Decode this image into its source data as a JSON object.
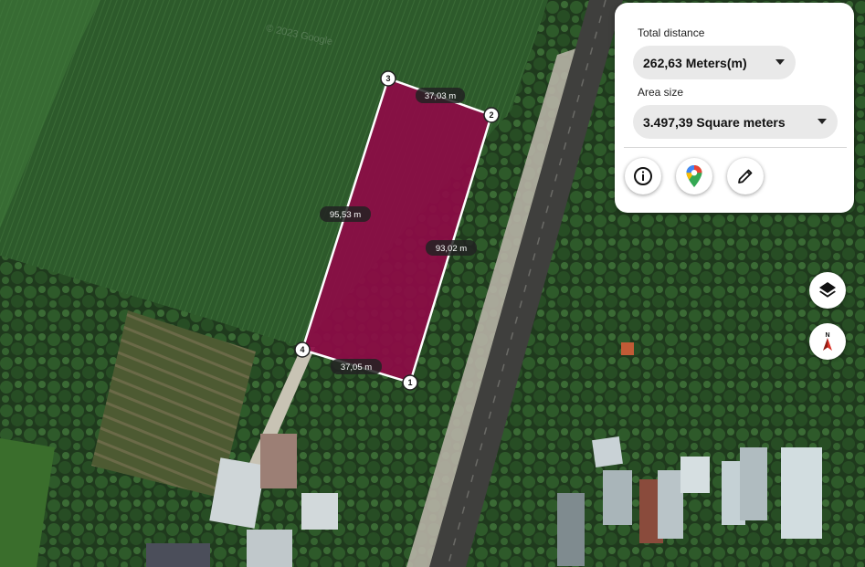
{
  "measure_panel": {
    "distance_label": "Total distance",
    "distance_value": "262,63 Meters(m)",
    "area_label": "Area size",
    "area_value": "3.497,39 Square meters"
  },
  "polygon": {
    "fill_color": "#8e0b46",
    "stroke_color": "#ffffff",
    "vertices": [
      {
        "label": "1"
      },
      {
        "label": "2"
      },
      {
        "label": "3"
      },
      {
        "label": "4"
      }
    ],
    "edges": [
      {
        "label": "37,03 m"
      },
      {
        "label": "95,53 m"
      },
      {
        "label": "93,02 m"
      },
      {
        "label": "37,05 m"
      }
    ]
  },
  "watermark": "© 2023 Google",
  "icons": {
    "info": "info-icon",
    "maps": "google-maps-pin-icon",
    "edit": "pencil-icon",
    "layers": "layers-icon",
    "compass": "compass-icon"
  },
  "colors": {
    "field": "#2f5c2c",
    "road": "#3f3f3d",
    "accent_north": "#d93025"
  }
}
